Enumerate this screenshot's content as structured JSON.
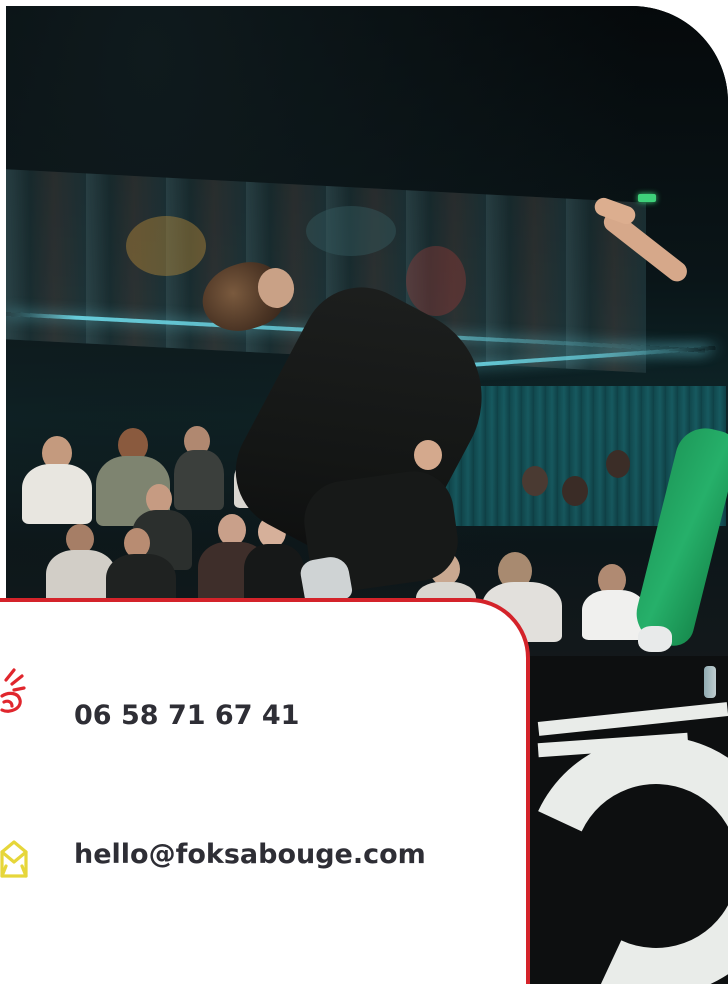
{
  "contact": {
    "phone": "06 58 71 67 41",
    "email": "hello@foksabouge.com",
    "phone_icon": "phone-ringing-icon",
    "email_icon": "envelope-icon"
  },
  "colors": {
    "card_border": "#d4232a",
    "phone_icon": "#e0262d",
    "email_icon": "#e6d63a",
    "text": "#2e2e35",
    "dancer_green": "#26b06a"
  },
  "photo": {
    "subject": "breakdance battle with audience"
  }
}
